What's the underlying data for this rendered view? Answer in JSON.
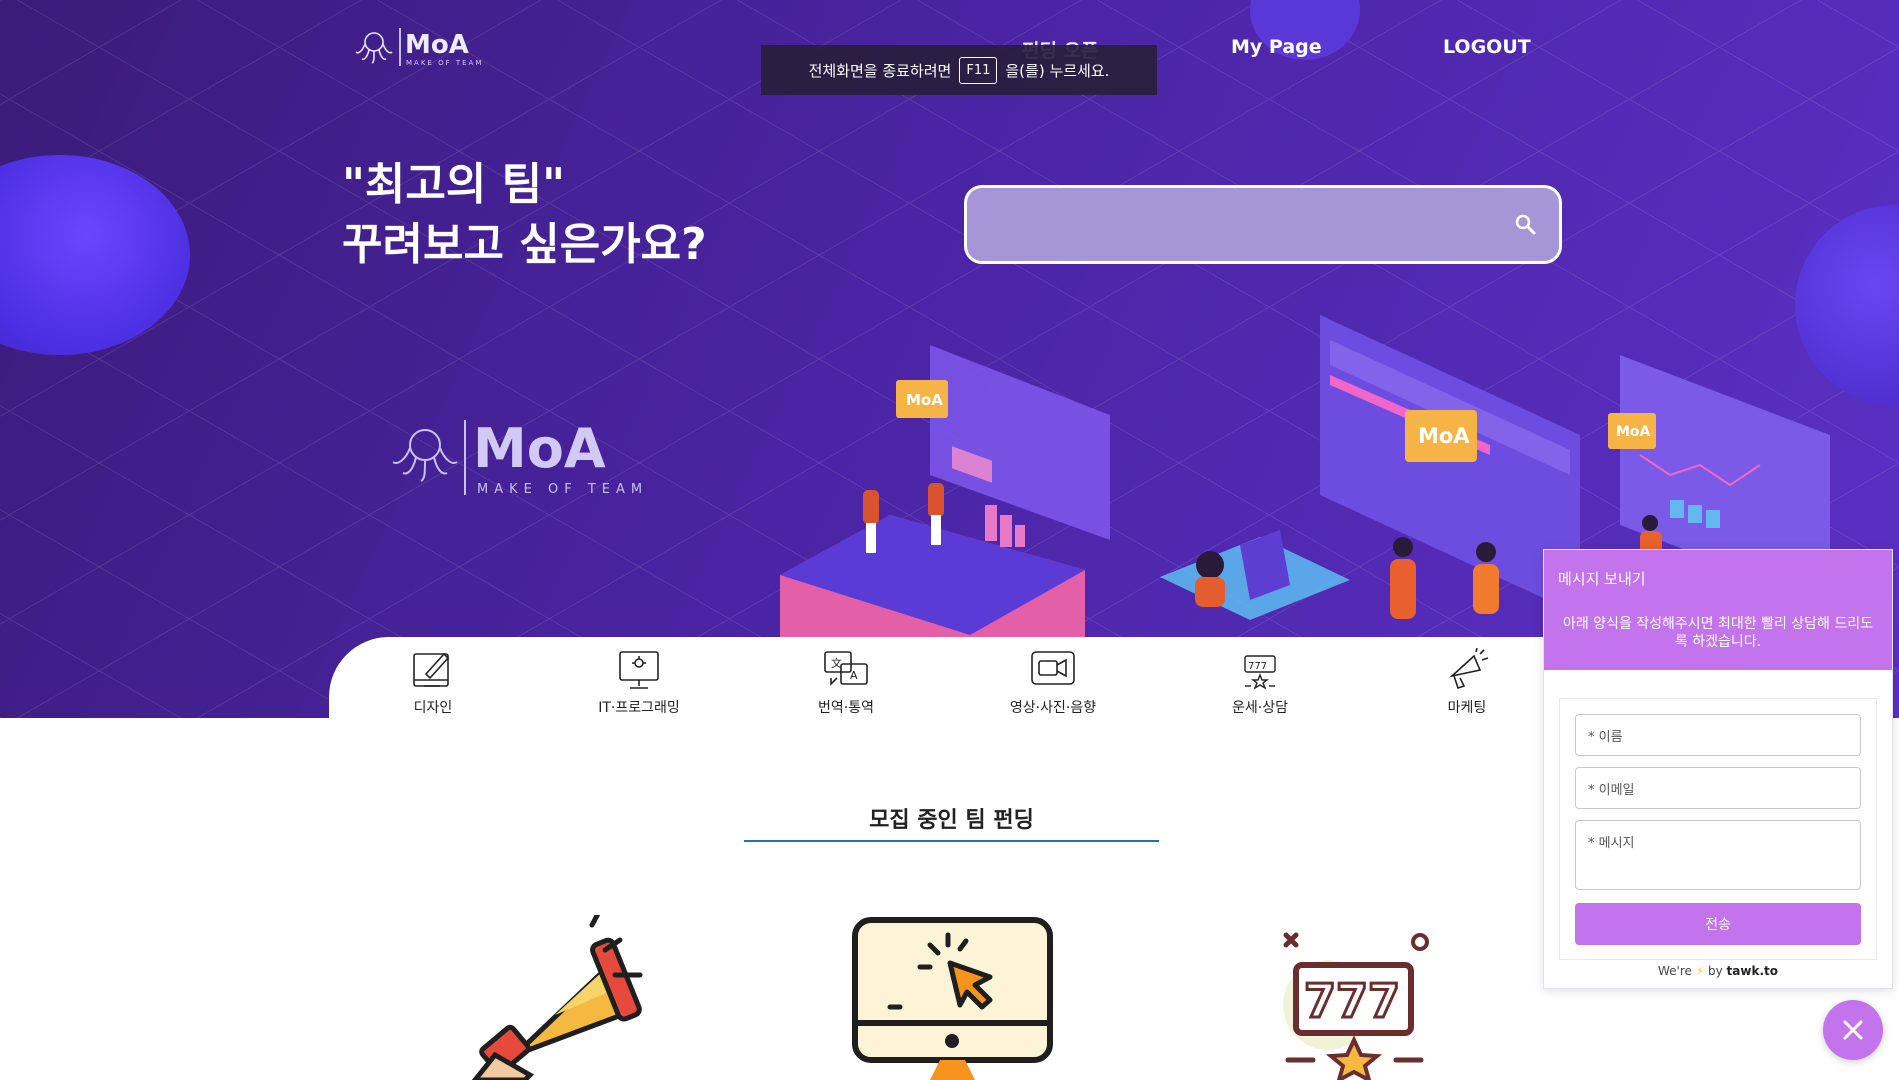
{
  "brand": {
    "name": "MoA",
    "tagline": "MAKE OF TEAM"
  },
  "nav": {
    "funding_label": "펀딩 오픈",
    "mypage_label": "My Page",
    "logout_label": "LOGOUT"
  },
  "fullscreen_toast": {
    "before": "전체화면을 종료하려면",
    "key": "F11",
    "after": "을(를) 누르세요."
  },
  "hero": {
    "headline_line1": "\"최고의 팀\"",
    "headline_line2": "꾸려보고 싶은가요?",
    "search_placeholder": "",
    "illustration_badge": "MoA"
  },
  "categories": [
    {
      "label": "디자인",
      "icon": "design-icon"
    },
    {
      "label": "IT·프로그래밍",
      "icon": "monitor-icon"
    },
    {
      "label": "번역·통역",
      "icon": "translate-icon"
    },
    {
      "label": "영상·사진·음향",
      "icon": "video-icon"
    },
    {
      "label": "운세·상담",
      "icon": "fortune-icon"
    },
    {
      "label": "마케팅",
      "icon": "megaphone-icon"
    }
  ],
  "recruit": {
    "title": "모집 중인 팀 펀딩"
  },
  "chat_widget": {
    "title": "메시지 보내기",
    "subtitle": "아래 양식을 작성해주시면 최대한 빨리 상담해 드리도록 하겠습니다.",
    "name_placeholder": "* 이름",
    "email_placeholder": "* 이메일",
    "message_placeholder": "* 메시지",
    "send_label": "전송",
    "brand_prefix": "We're",
    "brand_middle": "by",
    "brand_name": "tawk.to"
  },
  "colors": {
    "hero_bg": "#4a24a3",
    "widget_accent": "#c374ec",
    "title_underline": "#2b6fa8"
  }
}
